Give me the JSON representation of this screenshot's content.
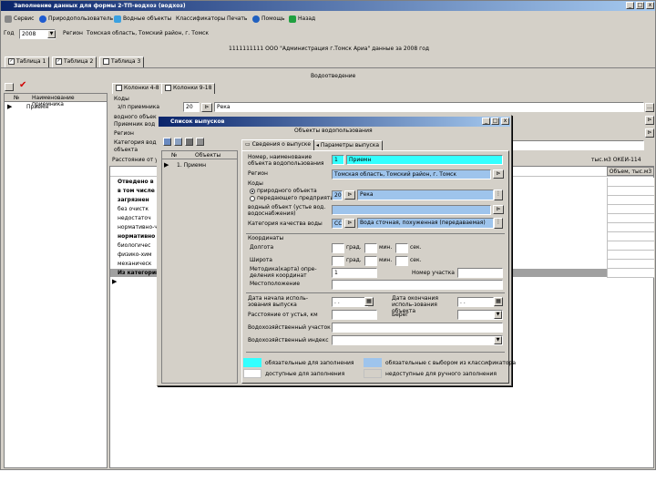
{
  "window": {
    "title": "Заполнение данных для формы 2-ТП-водхоз (водхоз)",
    "controls": {
      "min": "_",
      "max": "□",
      "close": "x"
    }
  },
  "menu": {
    "items": [
      {
        "label": "Сервис",
        "icon": "gear-icon"
      },
      {
        "label": "Природопользователь",
        "icon": "user-icon"
      },
      {
        "label": "Водные объекты",
        "icon": "water-icon"
      },
      {
        "label": "Классификаторы",
        "icon": ""
      },
      {
        "label": "Печать",
        "icon": ""
      },
      {
        "label": "Помощь",
        "icon": "help-icon"
      },
      {
        "label": "Назад",
        "icon": "back-icon"
      }
    ]
  },
  "filters": {
    "year_label": "Год",
    "year_value": "2008",
    "region_label": "Регион",
    "region_value": "Томская область, Томский район, г. Томск"
  },
  "header_line": "1111111111 ООО \"Администрация г.Томск Ариа\" данные за 2008 год",
  "section_title": "Водоотведение",
  "main_tabs": [
    "Таблица 1",
    "Таблица 2",
    "Таблица 3"
  ],
  "left_grid": {
    "col_num": "№",
    "col_name": "Наименование приемника",
    "rows": [
      "Приемн"
    ]
  },
  "sub_tabs": [
    "Колонки 4-8",
    "Колонки 9-18"
  ],
  "main_form": {
    "codes_label": "Коды",
    "receiver_label": "з/п приемника",
    "receiver_code": "20",
    "receiver_name": "Река",
    "water_object_label": "водного объекта",
    "receiver_water_label": "Приемник вод",
    "region_label": "Регион",
    "category_label": "Категория вод",
    "object_label": "объекта",
    "distance_label": "Расстояние от у",
    "unit_note": "тыс.м3  ОКЕИ-114",
    "volume_col": "Объем, тыс.м3"
  },
  "table_rows": [
    "Отведено в",
    "в том числе",
    "загрязнен",
    "без очистк",
    "недостаточ",
    "нормативно-ч",
    "нормативно",
    "биологичес",
    "физико-хим",
    "механическ",
    "Из категорий"
  ],
  "dialog": {
    "title": "Список выпусков",
    "subtitle": "Объекты водопользования",
    "tabs": [
      "Сведения о выпуске",
      "Параметры выпуска"
    ],
    "list": {
      "col_num": "№",
      "col_obj": "Объекты",
      "rows": [
        "1. Приемн"
      ]
    },
    "fields": {
      "name_label": "Номер, наименование объекта водопользования",
      "name_num": "1",
      "name_value": "Приемн",
      "region_label": "Регион",
      "region_value": "Томская область, Томский район, г. Томск",
      "codes_label": "Коды",
      "radio_water": "природного объекта",
      "radio_enterprise": "передающего предприятия",
      "code_num": "20",
      "code_value": "Река",
      "water_object_label": "водный объект (устье вод. водоснабжения)",
      "quality_label": "Категория качества воды",
      "quality_code": "СС",
      "quality_value": "Вода сточная, похуженная (передаваемая)",
      "coords_label": "Координаты",
      "longitude_label": "Долгота",
      "latitude_label": "Широта",
      "deg": "град.",
      "min": "мин.",
      "sec": "сек.",
      "method_label": "Методика(карта) опре-деления координат",
      "method_value": "1",
      "point_label": "Номер участка",
      "location_label": "Местоположение",
      "start_date_label": "Дата начала исполь-зования выпуска",
      "end_date_label": "Дата окончания исполь-зования объекта",
      "date_placeholder": ". .",
      "distance_label": "Расстояние от устья, км",
      "shore_label": "Берег",
      "basin_label": "Водохозяйственный участок",
      "basin_index_label": "Водохозяйственный индекс"
    },
    "legend": {
      "required": "обязательные для заполнения",
      "available": "доступные для заполнения",
      "required_classifier": "обязательные с выбором из классификатора",
      "unavailable": "недоступные для ручного заполнения"
    }
  },
  "colors": {
    "cyan": "#33ffff",
    "blue": "#9ec4ec",
    "title_start": "#0a246a",
    "title_end": "#a6caf0",
    "face": "#d4d0c8"
  }
}
